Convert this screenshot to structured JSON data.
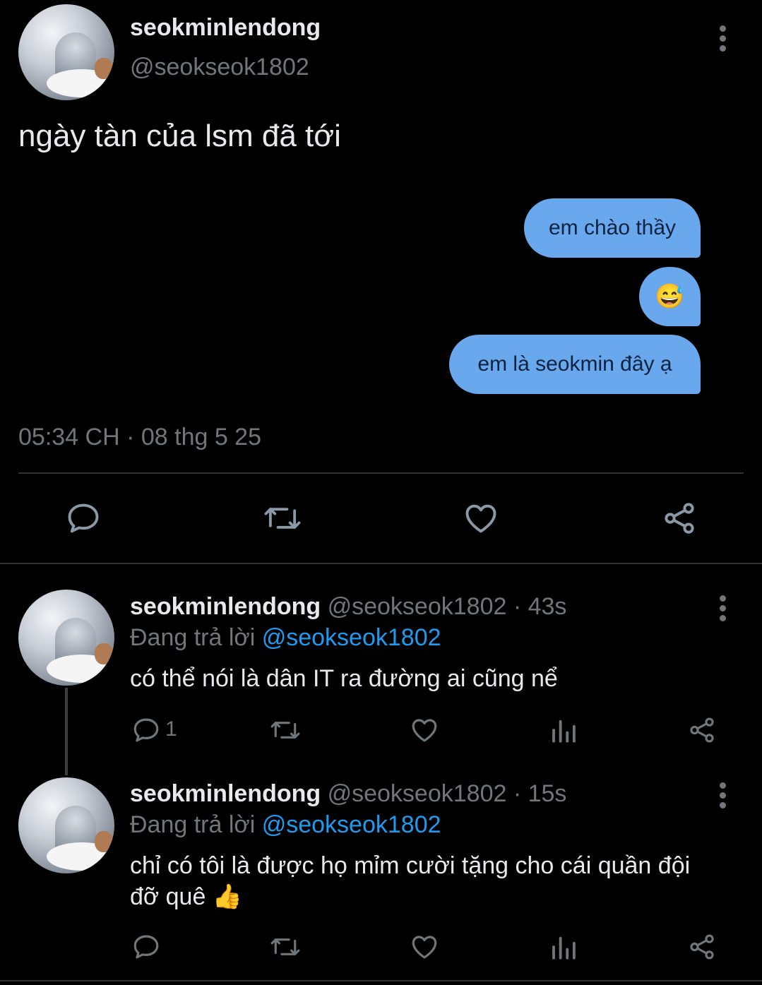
{
  "main_tweet": {
    "display_name": "seokminlendong",
    "handle": "@seokseok1802",
    "text": "ngày tàn của lsm đã tới",
    "timestamp": "05:34 CH · 08 thg 5 25",
    "chat_bubbles": [
      "em chào thầy",
      "😅",
      "em là seokmin đây ạ"
    ],
    "bubble_color": "#6aa8ee"
  },
  "replies": [
    {
      "display_name": "seokminlendong",
      "handle_time": "@seokseok1802 · 43s",
      "replying_prefix": "Đang trả lời",
      "replying_to": "@seokseok1802",
      "text": "có thể nói là dân IT ra đường ai cũng nể",
      "reply_count": "1"
    },
    {
      "display_name": "seokminlendong",
      "handle_time": "@seokseok1802 · 15s",
      "replying_prefix": "Đang trả lời",
      "replying_to": "@seokseok1802",
      "text_line1": "chỉ có tôi là được họ mỉm cười tặng cho cái quần đội",
      "text_line2": "đỡ quê 👍",
      "reply_count": ""
    }
  ],
  "icons": [
    "reply-icon",
    "retweet-icon",
    "like-icon",
    "share-icon",
    "views-icon",
    "more-icon"
  ],
  "colors": {
    "background": "#000000",
    "text": "#e7e9ea",
    "muted": "#71767b",
    "link": "#1d9bf0",
    "divider": "#2f3336"
  }
}
